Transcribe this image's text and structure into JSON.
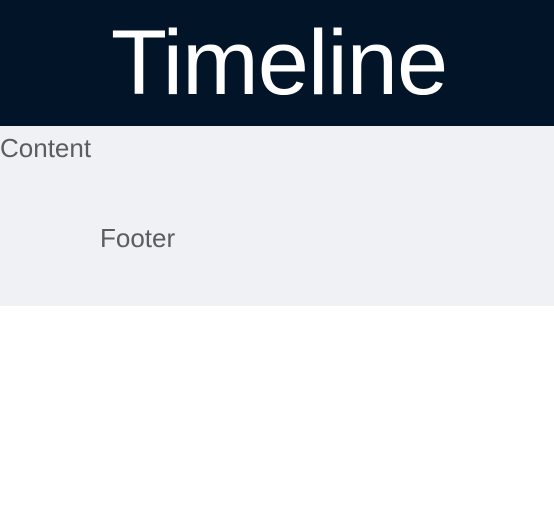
{
  "header": {
    "title": "Timeline"
  },
  "content": {
    "label": "Content",
    "footer_label": "Footer"
  },
  "colors": {
    "header_bg": "#011428",
    "header_text": "#ffffff",
    "content_bg": "#f0f1f5",
    "body_text": "#5a5d62"
  }
}
